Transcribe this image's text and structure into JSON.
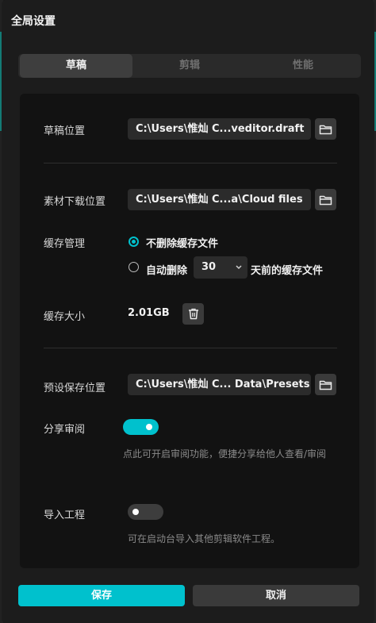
{
  "dialog": {
    "title": "全局设置"
  },
  "tabs": [
    {
      "label": "草稿",
      "active": true
    },
    {
      "label": "剪辑",
      "active": false
    },
    {
      "label": "性能",
      "active": false
    }
  ],
  "draft_location": {
    "label": "草稿位置",
    "value": "C:\\Users\\惟灿 C...veditor.draft"
  },
  "material_location": {
    "label": "素材下载位置",
    "value": "C:\\Users\\惟灿 C...a\\Cloud files"
  },
  "cache": {
    "label": "缓存管理",
    "option_keep": "不删除缓存文件",
    "option_auto_prefix": "自动删除",
    "days_value": "30",
    "option_auto_suffix": "天前的缓存文件",
    "selected": "keep",
    "size_label": "缓存大小",
    "size_value": "2.01GB"
  },
  "preset_location": {
    "label": "预设保存位置",
    "value": "C:\\Users\\惟灿 C... Data\\Presets"
  },
  "share_review": {
    "label": "分享审阅",
    "enabled": true,
    "hint": "点此可开启审阅功能，便捷分享给他人查看/审阅"
  },
  "import_project": {
    "label": "导入工程",
    "enabled": false,
    "hint": "可在启动台导入其他剪辑软件工程。"
  },
  "footer": {
    "save_label": "保存",
    "cancel_label": "取消"
  },
  "colors": {
    "accent": "#00c1cd",
    "panel": "#121212",
    "field": "#2b2b2b"
  },
  "icons": {
    "folder": "folder-icon",
    "trash": "trash-icon",
    "chevron": "chevron-down-icon"
  }
}
